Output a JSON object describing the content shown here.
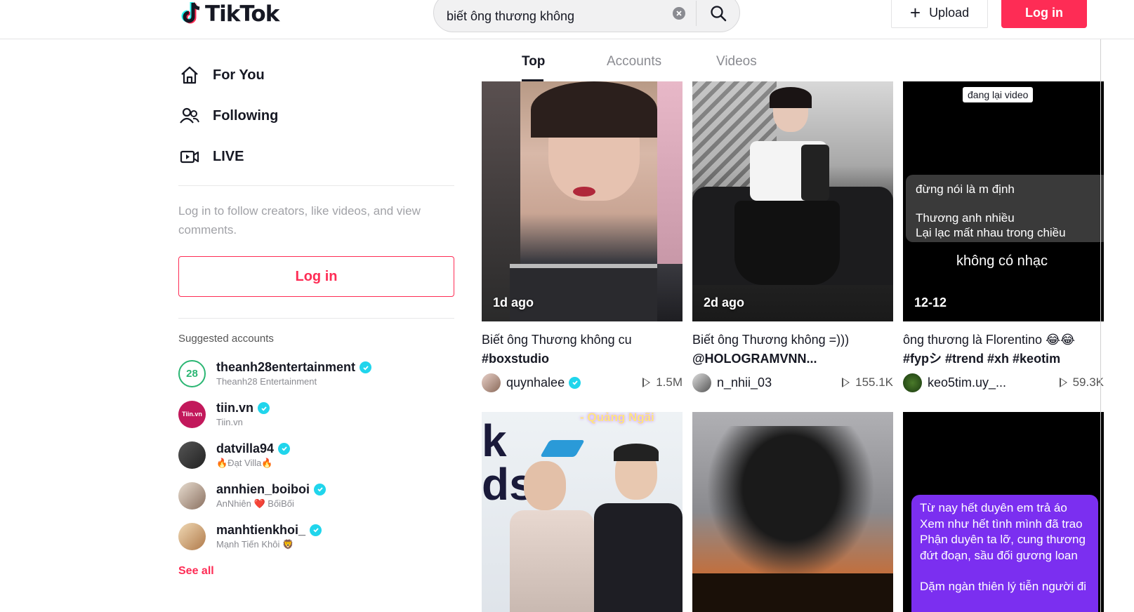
{
  "header": {
    "logo_text": "TikTok",
    "search_value": "biết ông thương không",
    "upload_label": "Upload",
    "login_label": "Log in"
  },
  "sidebar": {
    "nav": [
      {
        "label": "For You",
        "icon": "home-icon"
      },
      {
        "label": "Following",
        "icon": "following-icon"
      },
      {
        "label": "LIVE",
        "icon": "live-icon"
      }
    ],
    "login_hint": "Log in to follow creators, like videos, and view comments.",
    "login_button": "Log in",
    "suggested_title": "Suggested accounts",
    "accounts": [
      {
        "username": "theanh28entertainment",
        "display": "Theanh28 Entertainment"
      },
      {
        "username": "tiin.vn",
        "display": "Tiin.vn"
      },
      {
        "username": "datvilla94",
        "display": "🔥Đạt Villa🔥"
      },
      {
        "username": "annhien_boiboi",
        "display": "AnNhiên ❤️ BốiBối"
      },
      {
        "username": "manhtienkhoi_",
        "display": "Mạnh Tiến Khôi 🦁"
      }
    ],
    "see_all": "See all"
  },
  "tabs": [
    "Top",
    "Accounts",
    "Videos"
  ],
  "videos": [
    {
      "overlay": "1d ago",
      "desc_text": "Biết ông Thương không cu",
      "desc_tags": "#boxstudio",
      "author": "quynhalee",
      "verified": true,
      "views": "1.5M"
    },
    {
      "overlay": "2d ago",
      "desc_text": "Biết ông Thương không =)))",
      "desc_tags": "@HOLOGRAMVNN...",
      "author": "n_nhii_03",
      "verified": false,
      "views": "155.1K"
    },
    {
      "overlay": "12-12",
      "desc_text": "ông thương là Florentino 😂😂",
      "desc_tags": "#fypシ #trend #xh #keotim",
      "author": "keo5tim.uy_...",
      "verified": false,
      "views": "59.3K",
      "thumb_tag": "đang lại video",
      "thumb_lines": [
        "đừng nói là m định",
        "Thương anh nhiều",
        "Lại lạc mất nhau trong chiều"
      ],
      "thumb_caption": "không có nhạc"
    },
    {
      "thumb_text": "- Quảng Ngãi"
    },
    {},
    {
      "lyrics": [
        "Từ nay hết duyên em trả áo",
        "Xem như hết tình mình đã trao",
        "Phận duyên ta lỡ, cung thương",
        "đứt đoạn, sầu đối gương loan",
        "",
        "Dặm ngàn thiên lý tiễn người đi"
      ]
    }
  ],
  "colors": {
    "accent": "#fe2c55",
    "verified": "#20d5ec"
  }
}
